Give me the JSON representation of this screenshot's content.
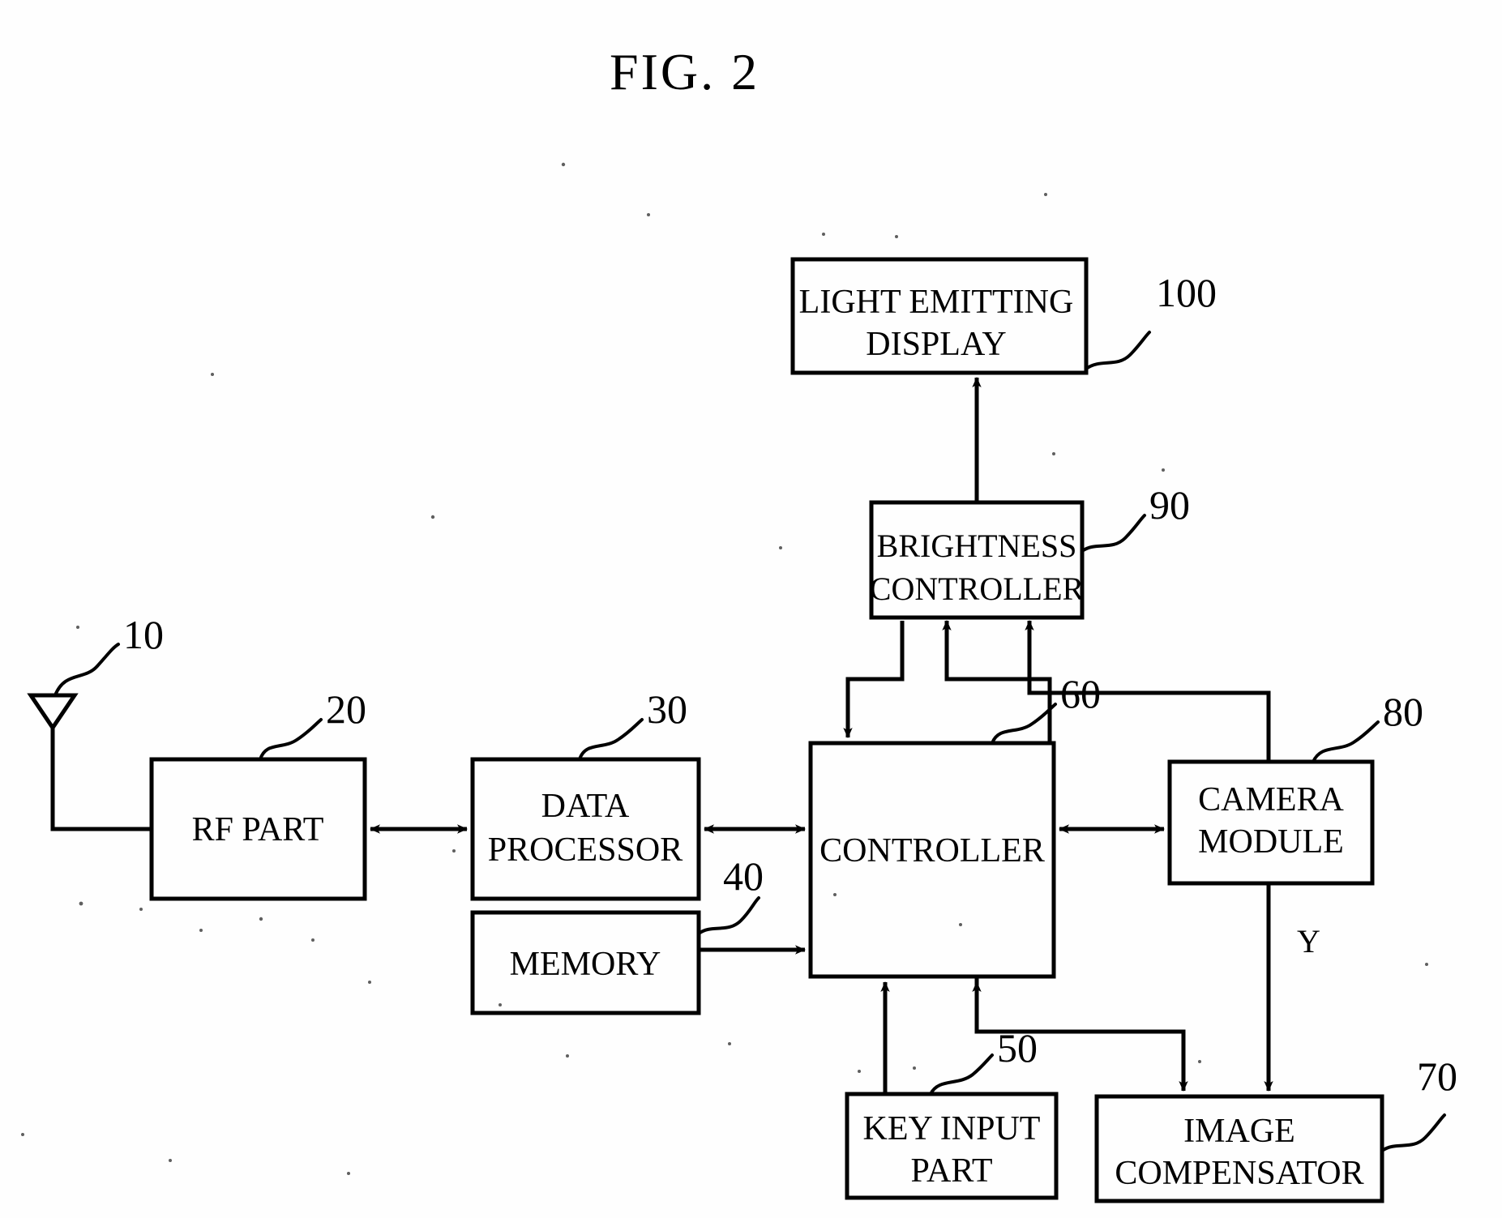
{
  "figure": {
    "title": "FIG. 2",
    "kind": "block-diagram",
    "ink_color": "#000000",
    "background_color": "#ffffff"
  },
  "blocks": [
    {
      "id": "antenna",
      "ref": "10",
      "label_line1": "",
      "label_line2": "",
      "shape": "antenna-symbol"
    },
    {
      "id": "rf",
      "ref": "20",
      "label_line1": "RF PART",
      "label_line2": "",
      "shape": "rect"
    },
    {
      "id": "dataproc",
      "ref": "30",
      "label_line1": "DATA",
      "label_line2": "PROCESSOR",
      "shape": "rect"
    },
    {
      "id": "memory",
      "ref": "40",
      "label_line1": "MEMORY",
      "label_line2": "",
      "shape": "rect"
    },
    {
      "id": "keyinput",
      "ref": "50",
      "label_line1": "KEY INPUT",
      "label_line2": "PART",
      "shape": "rect"
    },
    {
      "id": "controller",
      "ref": "60",
      "label_line1": "CONTROLLER",
      "label_line2": "",
      "shape": "rect"
    },
    {
      "id": "imagecomp",
      "ref": "70",
      "label_line1": "IMAGE",
      "label_line2": "COMPENSATOR",
      "shape": "rect"
    },
    {
      "id": "camera",
      "ref": "80",
      "label_line1": "CAMERA",
      "label_line2": "MODULE",
      "shape": "rect"
    },
    {
      "id": "brightness",
      "ref": "90",
      "label_line1": "BRIGHTNESS",
      "label_line2": "CONTROLLER",
      "shape": "rect"
    },
    {
      "id": "display",
      "ref": "100",
      "label_line1": "LIGHT EMITTING",
      "label_line2": "DISPLAY",
      "shape": "rect"
    }
  ],
  "signal_labels": [
    {
      "id": "y-signal",
      "text": "Y"
    }
  ],
  "connections": [
    {
      "from": "antenna",
      "to": "rf",
      "arrow": "none"
    },
    {
      "from": "rf",
      "to": "dataproc",
      "arrow": "both"
    },
    {
      "from": "dataproc",
      "to": "controller",
      "arrow": "both"
    },
    {
      "from": "memory",
      "to": "controller",
      "arrow": "single"
    },
    {
      "from": "keyinput",
      "to": "controller",
      "arrow": "single"
    },
    {
      "from": "controller",
      "to": "imagecomp",
      "arrow": "single"
    },
    {
      "from": "controller",
      "to": "camera",
      "arrow": "both"
    },
    {
      "from": "controller",
      "to": "brightness",
      "arrow": "single"
    },
    {
      "from": "brightness",
      "to": "controller",
      "arrow": "single"
    },
    {
      "from": "camera",
      "to": "brightness",
      "arrow": "single"
    },
    {
      "from": "camera",
      "to": "imagecomp",
      "arrow": "single",
      "signal": "Y"
    },
    {
      "from": "brightness",
      "to": "display",
      "arrow": "single"
    }
  ]
}
